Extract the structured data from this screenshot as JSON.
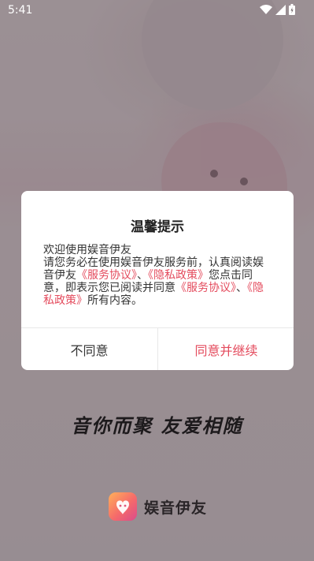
{
  "status_bar": {
    "time": "5:41",
    "icons": [
      "wifi-icon",
      "signal-icon",
      "battery-icon"
    ]
  },
  "dialog": {
    "title": "温馨提示",
    "body": {
      "line1": "欢迎使用娱音伊友",
      "segments": [
        {
          "text": "请您务必在使用娱音伊友服务前，认真阅读娱音伊友",
          "link": false
        },
        {
          "text": "《服务协议》",
          "link": true
        },
        {
          "text": "、",
          "link": false
        },
        {
          "text": "《隐私政策》",
          "link": true
        },
        {
          "text": "您点击同意，即表示您已阅读并同意",
          "link": false
        },
        {
          "text": "《服务协议》",
          "link": true
        },
        {
          "text": "、",
          "link": false
        },
        {
          "text": "《隐私政策》",
          "link": true
        },
        {
          "text": "所有内容。",
          "link": false
        }
      ]
    },
    "decline_label": "不同意",
    "accept_label": "同意并继续"
  },
  "splash": {
    "slogan": "音你而聚 友爱相随",
    "app_name": "娱音伊友"
  },
  "colors": {
    "accent": "#e44b5d",
    "text_primary": "#222222",
    "background": "#f3e6ea"
  }
}
